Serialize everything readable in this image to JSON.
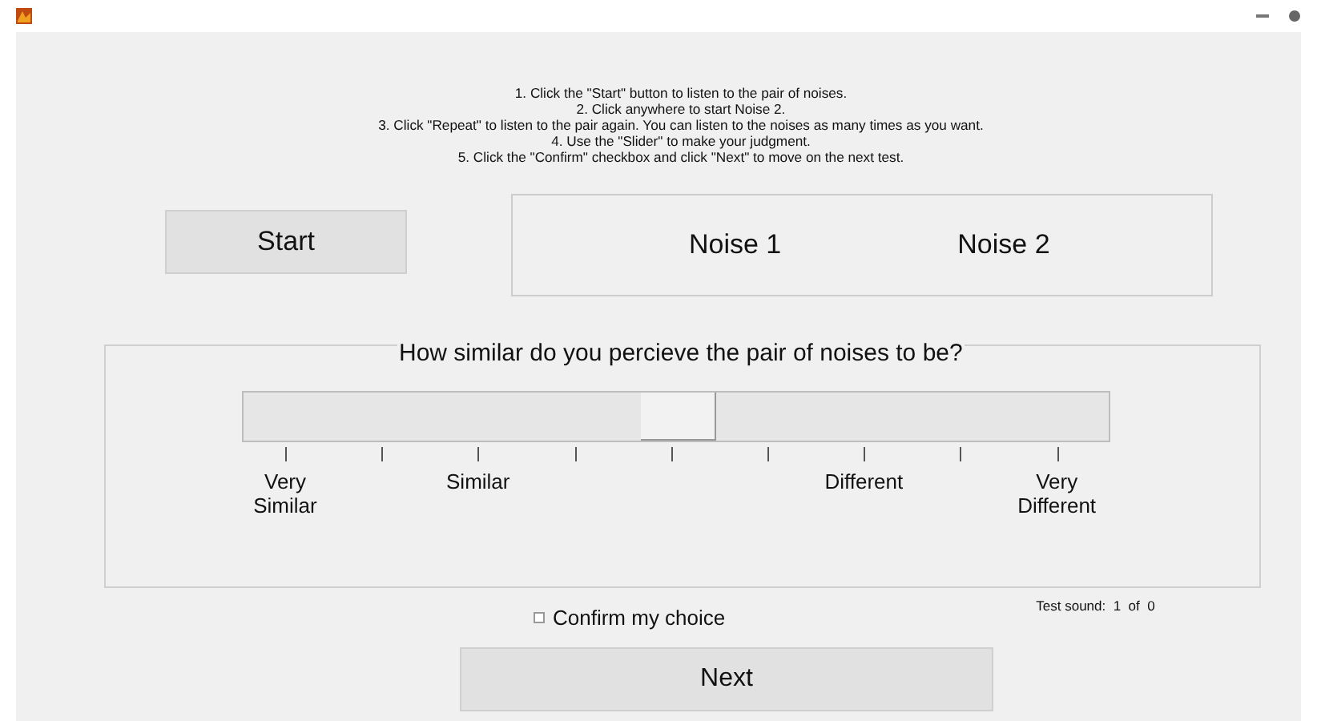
{
  "instructions": [
    "1. Click the \"Start\" button to listen to the pair of noises.",
    "2. Click anywhere to start Noise 2.",
    "3. Click \"Repeat\" to listen to the pair again.  You can listen to the noises as many times as you want.",
    "4. Use the \"Slider\" to make your judgment.",
    "5. Click the \"Confirm\" checkbox and click \"Next\" to move on the next test."
  ],
  "start_button": "Start",
  "noises": [
    "Noise 1",
    "Noise 2"
  ],
  "question": "How similar do you percieve the pair of noises to be?",
  "slider": {
    "level": 0.5
  },
  "scale_labels": [
    "Very Similar",
    "Similar",
    "Different",
    "Very Different"
  ],
  "confirm": {
    "label": "Confirm my choice",
    "checked": false
  },
  "test_sound": "Test sound:  1  of  0",
  "next_button": "Next"
}
